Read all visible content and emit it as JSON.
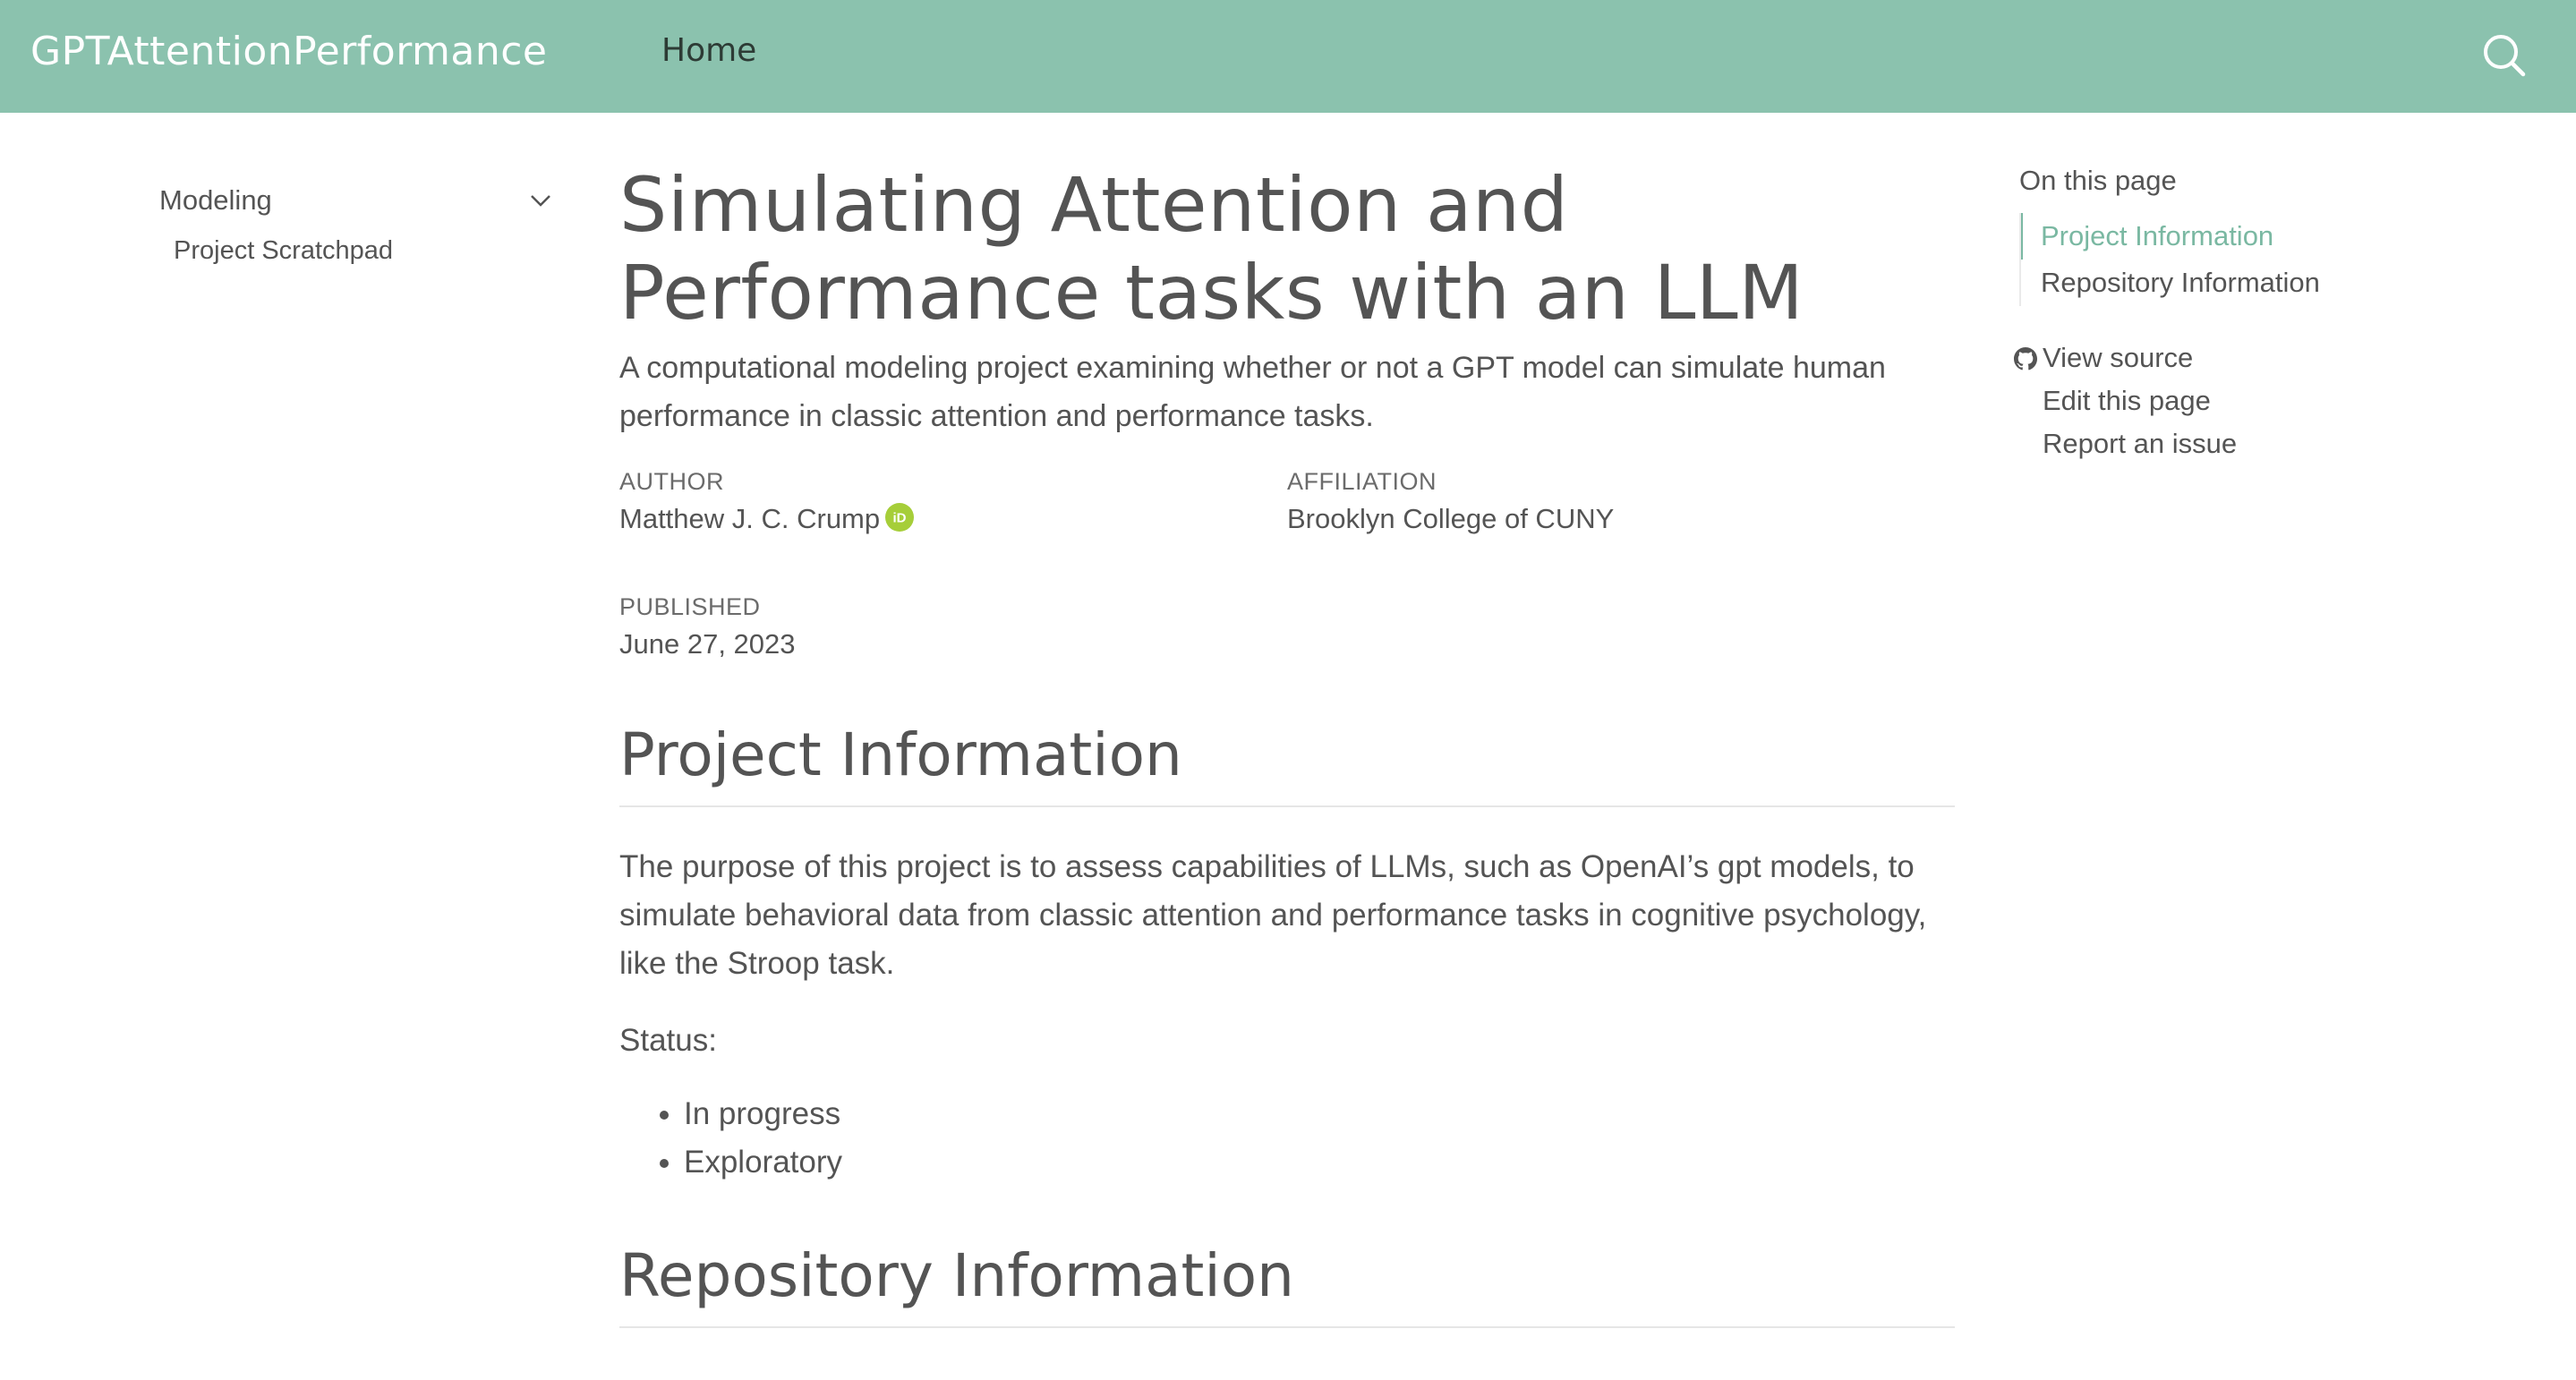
{
  "navbar": {
    "brand": "GPTAttentionPerformance",
    "home_label": "Home",
    "search_icon": "search-icon"
  },
  "colors": {
    "navbar_bg": "#8bc2ae",
    "accent": "#7ab8a2",
    "text": "#545454",
    "orcid": "#a6ce39"
  },
  "sidebar": {
    "section_label": "Modeling",
    "section_icon": "chevron-down-icon",
    "items": [
      {
        "label": "Project Scratchpad"
      }
    ]
  },
  "main": {
    "title": "Simulating Attention and Performance tasks with an LLM",
    "subtitle": "A computational modeling project examining whether or not a GPT model can simulate human performance in classic attention and performance tasks.",
    "meta": {
      "author_label": "AUTHOR",
      "author": "Matthew J. C. Crump",
      "author_icon": "orcid-icon",
      "affiliation_label": "AFFILIATION",
      "affiliation": "Brooklyn College of CUNY",
      "published_label": "PUBLISHED",
      "published": "June 27, 2023"
    },
    "sections": [
      {
        "heading": "Project Information",
        "paragraph": "The purpose of this project is to assess capabilities of LLMs, such as OpenAI’s gpt models, to simulate behavioral data from classic attention and performance tasks in cognitive psychology, like the Stroop task.",
        "status_label": "Status:",
        "status_items": [
          "In progress",
          "Exploratory"
        ]
      },
      {
        "heading": "Repository Information"
      }
    ]
  },
  "toc": {
    "title": "On this page",
    "items": [
      {
        "label": "Project Information",
        "active": true
      },
      {
        "label": "Repository Information",
        "active": false
      }
    ],
    "actions": [
      {
        "label": "View source",
        "icon": "github-icon"
      },
      {
        "label": "Edit this page"
      },
      {
        "label": "Report an issue"
      }
    ]
  }
}
